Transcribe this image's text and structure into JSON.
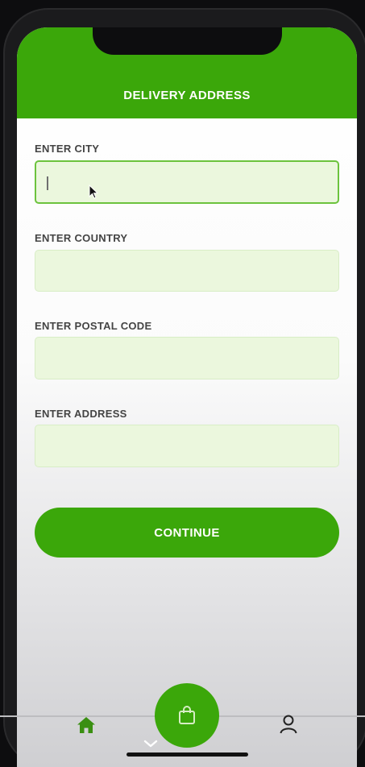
{
  "header": {
    "title": "DELIVERY ADDRESS"
  },
  "form": {
    "fields": [
      {
        "label": "ENTER CITY",
        "value": "",
        "placeholder": ""
      },
      {
        "label": "ENTER COUNTRY",
        "value": "",
        "placeholder": ""
      },
      {
        "label": "ENTER POSTAL CODE",
        "value": "",
        "placeholder": ""
      },
      {
        "label": "ENTER ADDRESS",
        "value": "",
        "placeholder": ""
      }
    ],
    "continue_label": "CONTINUE"
  },
  "tabbar": {
    "items": [
      {
        "icon": "home-icon"
      },
      {
        "icon": "shopping-bag-icon"
      },
      {
        "icon": "user-icon"
      }
    ]
  },
  "colors": {
    "accent": "#3ba70a",
    "input_background": "#ebf7dd",
    "input_border_focused": "#6cc33d"
  }
}
